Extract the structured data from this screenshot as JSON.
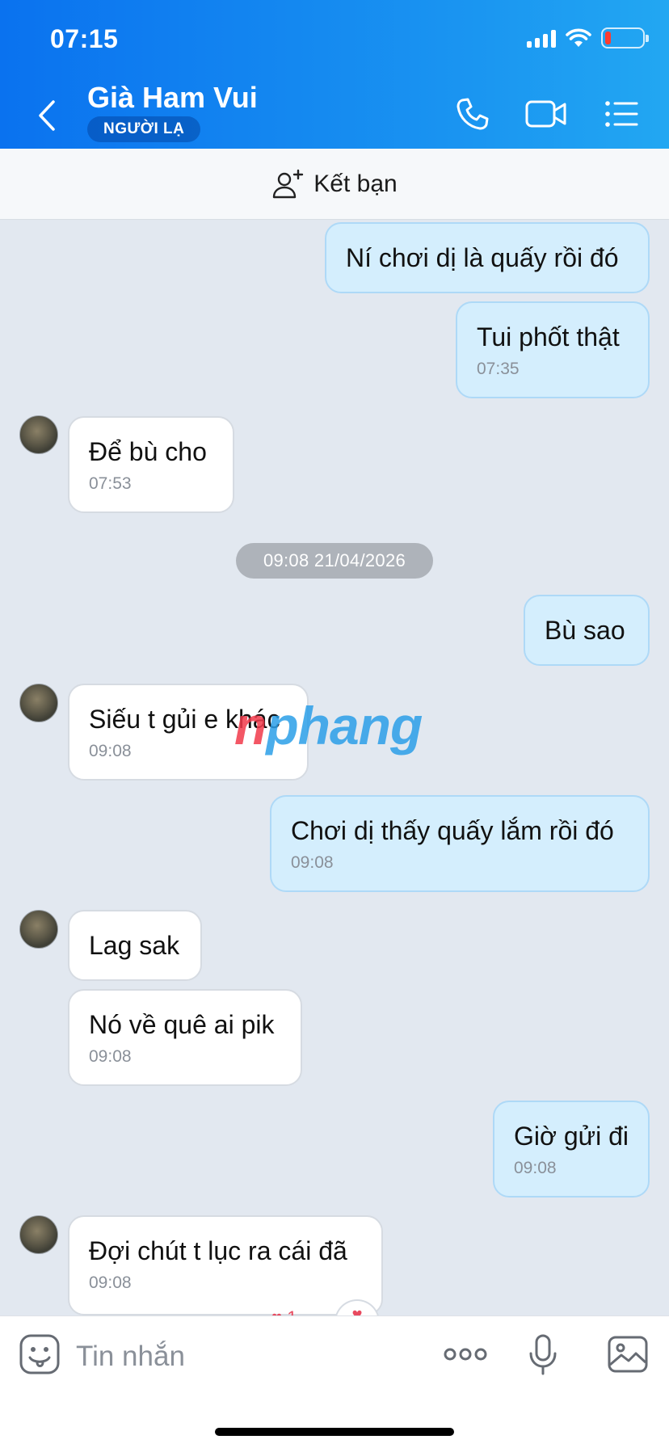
{
  "status_bar": {
    "time": "07:15",
    "battery_color": "#ff3b30"
  },
  "header": {
    "contact_name": "Già Ham Vui",
    "badge": "NGƯỜI LẠ",
    "icons": [
      "back-icon",
      "phone-icon",
      "video-call-icon",
      "menu-list-icon"
    ]
  },
  "friend_bar": {
    "label": "Kết bạn",
    "icon": "add-person-icon"
  },
  "messages": [
    {
      "side": "me",
      "text": "Ní chơi dị là quấy rồi đó",
      "time": ""
    },
    {
      "side": "me",
      "text": "Tui phốt thật",
      "time": "07:35"
    },
    {
      "side": "them",
      "text": "Để bù cho",
      "time": "07:53"
    },
    {
      "side": "me",
      "text": "Bù sao",
      "time": ""
    },
    {
      "side": "them",
      "text": "Siếu t gủi e khác",
      "time": "09:08"
    },
    {
      "side": "me",
      "text": "Chơi dị thấy quấy lắm rồi đó",
      "time": "09:08"
    },
    {
      "side": "them",
      "text": "Lag sak",
      "time": ""
    },
    {
      "side": "them",
      "text": "Nó về quê ai pik",
      "time": "09:08"
    },
    {
      "side": "me",
      "text": "Giờ gửi đi",
      "time": "09:08"
    },
    {
      "side": "them",
      "text": "Đợi chút t lục ra cái đã",
      "time": "09:08"
    }
  ],
  "date_separator": "09:08 21/04/2026",
  "watermark": {
    "first": "n",
    "rest": "phang"
  },
  "reaction": {
    "count": "1",
    "icon": "heart-icon"
  },
  "input_bar": {
    "placeholder": "Tin nhắn",
    "icons": [
      "sticker-icon",
      "more-dots-icon",
      "microphone-icon",
      "image-icon"
    ]
  },
  "colors": {
    "header_start": "#0a72ef",
    "header_end": "#22a7f2",
    "my_bubble": "#d4eefd",
    "chat_bg": "#e2e8f0"
  }
}
